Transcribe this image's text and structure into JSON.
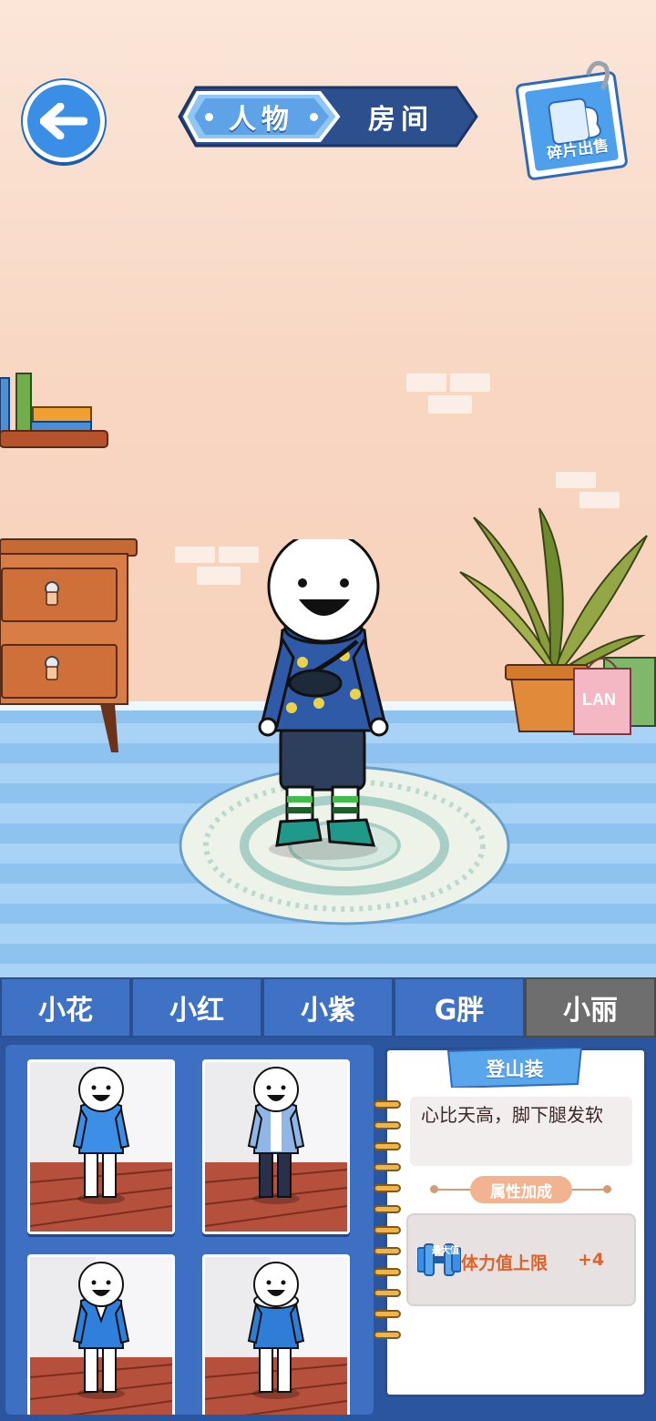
{
  "header": {
    "back_icon": "arrow-left-icon",
    "tabs": [
      {
        "label": "人物",
        "active": true
      },
      {
        "label": "房间",
        "active": false
      }
    ],
    "sell_button": {
      "label": "碎片出售",
      "icon": "fragment-card-icon"
    }
  },
  "characters": [
    {
      "label": "小花",
      "active": false
    },
    {
      "label": "小红",
      "active": false
    },
    {
      "label": "小紫",
      "active": false
    },
    {
      "label": "G胖",
      "active": false
    },
    {
      "label": "小丽",
      "active": true
    }
  ],
  "outfits": [
    {
      "name": "blue-sweater-outfit",
      "color": "#3d8ee6"
    },
    {
      "name": "denim-jacket-outfit",
      "color": "#8fb6e6"
    },
    {
      "name": "blue-suit-outfit",
      "color": "#2f7fdc"
    },
    {
      "name": "blue-hoodie-outfit",
      "color": "#2e7ed8"
    }
  ],
  "detail": {
    "name": "登山装",
    "description": "心比天高，脚下腿发软",
    "attr_title": "属性加成",
    "max_tag": "最大值",
    "stat_icon": "dumbbell-icon",
    "stat_label": "体力值上限",
    "stat_value": "+4"
  },
  "colors": {
    "accent_blue": "#3f72c4",
    "active_tab_gray": "#6e6e6e",
    "stat_orange": "#e0622a"
  }
}
